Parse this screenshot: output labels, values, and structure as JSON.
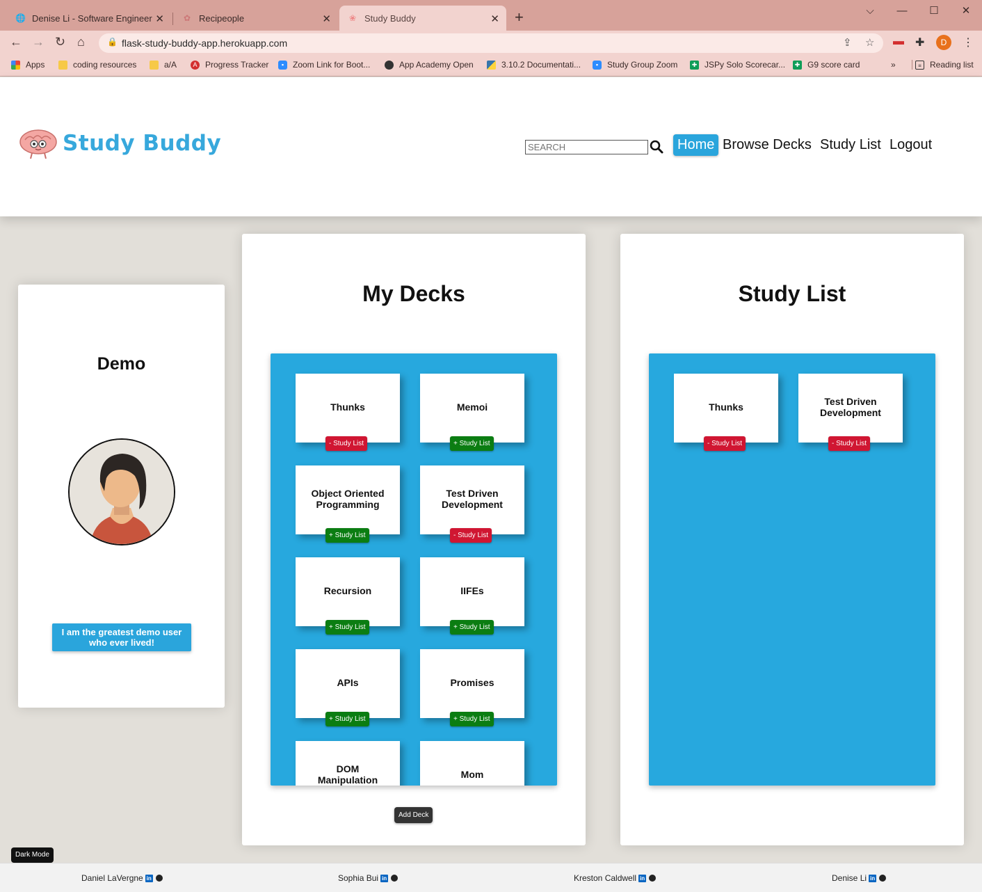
{
  "browser": {
    "tabs": [
      {
        "title": "Denise Li - Software Engineer",
        "icon": "globe-icon"
      },
      {
        "title": "Recipeople",
        "icon": "recipe-icon"
      },
      {
        "title": "Study Buddy",
        "icon": "brain-icon"
      }
    ],
    "url": "flask-study-buddy-app.herokuapp.com",
    "profile_initial": "D",
    "bookmarks": [
      {
        "label": "Apps",
        "color": "#e84335"
      },
      {
        "label": "coding resources",
        "color": "#f5c518"
      },
      {
        "label": "a/A",
        "color": "#f5c518"
      },
      {
        "label": "Progress Tracker",
        "color": "#d32f2f"
      },
      {
        "label": "Zoom Link for Boot...",
        "color": "#2d8cff"
      },
      {
        "label": "App Academy Open",
        "color": "#222222"
      },
      {
        "label": "3.10.2 Documentati...",
        "color": "#3776ab"
      },
      {
        "label": "Study Group Zoom",
        "color": "#2d8cff"
      },
      {
        "label": "JSPy Solo Scorecar...",
        "color": "#0f9d58"
      },
      {
        "label": "G9 score card",
        "color": "#0f9d58"
      }
    ],
    "more_bookmarks": "»",
    "reading_list": "Reading list"
  },
  "header": {
    "brand": "Study Buddy",
    "search_placeholder": "SEARCH",
    "nav": [
      "Home",
      "Browse Decks",
      "Study List",
      "Logout"
    ],
    "active_nav": "Home"
  },
  "profile": {
    "name": "Demo",
    "bio": "I am the greatest demo user who ever lived!"
  },
  "my_decks": {
    "title": "My Decks",
    "decks": [
      {
        "name": "Thunks",
        "action": "- Study List",
        "in_list": true
      },
      {
        "name": "Memoi",
        "action": "+ Study List",
        "in_list": false
      },
      {
        "name": "Object Oriented Programming",
        "action": "+ Study List",
        "in_list": false
      },
      {
        "name": "Test Driven Development",
        "action": "- Study List",
        "in_list": true
      },
      {
        "name": "Recursion",
        "action": "+ Study List",
        "in_list": false
      },
      {
        "name": "IIFEs",
        "action": "+ Study List",
        "in_list": false
      },
      {
        "name": "APIs",
        "action": "+ Study List",
        "in_list": false
      },
      {
        "name": "Promises",
        "action": "+ Study List",
        "in_list": false
      },
      {
        "name": "DOM Manipulation",
        "action": "",
        "in_list": false
      },
      {
        "name": "Mom",
        "action": "",
        "in_list": false
      }
    ],
    "add_deck": "Add Deck"
  },
  "study_list": {
    "title": "Study List",
    "decks": [
      {
        "name": "Thunks",
        "action": "- Study List"
      },
      {
        "name": "Test Driven Development",
        "action": "- Study List"
      }
    ]
  },
  "dark_mode": "Dark Mode",
  "footer": {
    "credits": [
      "Daniel LaVergne",
      "Sophia Bui",
      "Kreston Caldwell",
      "Denise Li"
    ]
  },
  "colors": {
    "accent": "#2aa5dc",
    "remove": "#d01632",
    "add": "#0b7d12"
  }
}
